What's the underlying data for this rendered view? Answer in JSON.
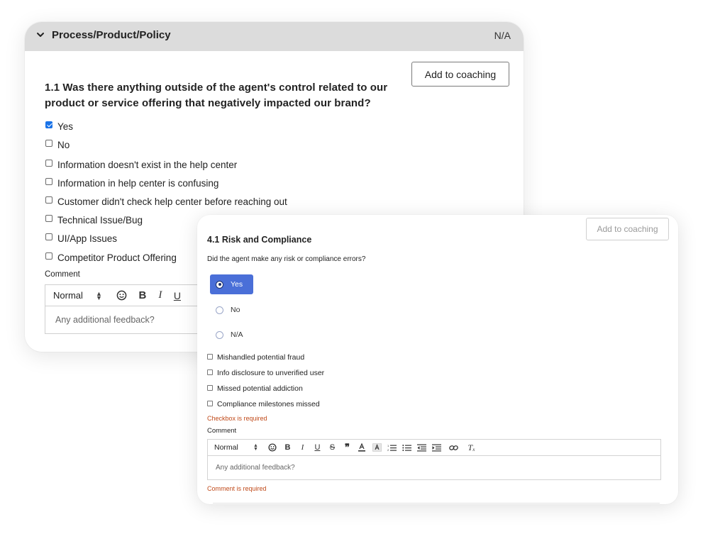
{
  "back_card": {
    "section_title": "Process/Product/Policy",
    "na_label": "N/A",
    "add_to_coaching": "Add to coaching",
    "question": "1.1  Was there anything outside of the agent's control related to our product or service offering that negatively impacted our brand?",
    "options": [
      {
        "label": "Yes",
        "checked": true
      },
      {
        "label": "No",
        "checked": false
      },
      {
        "label": "Information doesn't exist in the help center",
        "checked": false
      },
      {
        "label": "Information in help center is confusing",
        "checked": false
      },
      {
        "label": "Customer didn't check help center before reaching out",
        "checked": false
      },
      {
        "label": "Technical Issue/Bug",
        "checked": false
      },
      {
        "label": "UI/App Issues",
        "checked": false
      },
      {
        "label": "Competitor Product Offering",
        "checked": false
      }
    ],
    "comment_label": "Comment",
    "toolbar": {
      "format_select": "Normal"
    },
    "comment_placeholder": "Any additional feedback?"
  },
  "front_card": {
    "add_to_coaching": "Add to coaching",
    "section_title": "4.1  Risk and Compliance",
    "question": "Did the agent make any risk or compliance errors?",
    "radio_options": [
      {
        "label": "Yes",
        "selected": true
      },
      {
        "label": "No",
        "selected": false
      },
      {
        "label": "N/A",
        "selected": false
      }
    ],
    "checkboxes": [
      {
        "label": "Mishandled potential fraud",
        "checked": false
      },
      {
        "label": "Info disclosure to unverified user",
        "checked": false
      },
      {
        "label": "Missed potential addiction",
        "checked": false
      },
      {
        "label": "Compliance milestones missed",
        "checked": false
      }
    ],
    "checkbox_error": "Checkbox is required",
    "comment_label": "Comment",
    "toolbar": {
      "format_select": "Normal"
    },
    "comment_placeholder": "Any additional feedback?",
    "comment_error": "Comment is required"
  },
  "colors": {
    "header_bg": "#dcdcdc",
    "checkbox_checked": "#1a73e8",
    "radio_selected_bg": "#4a6fd8",
    "error_text": "#c04a1a"
  }
}
